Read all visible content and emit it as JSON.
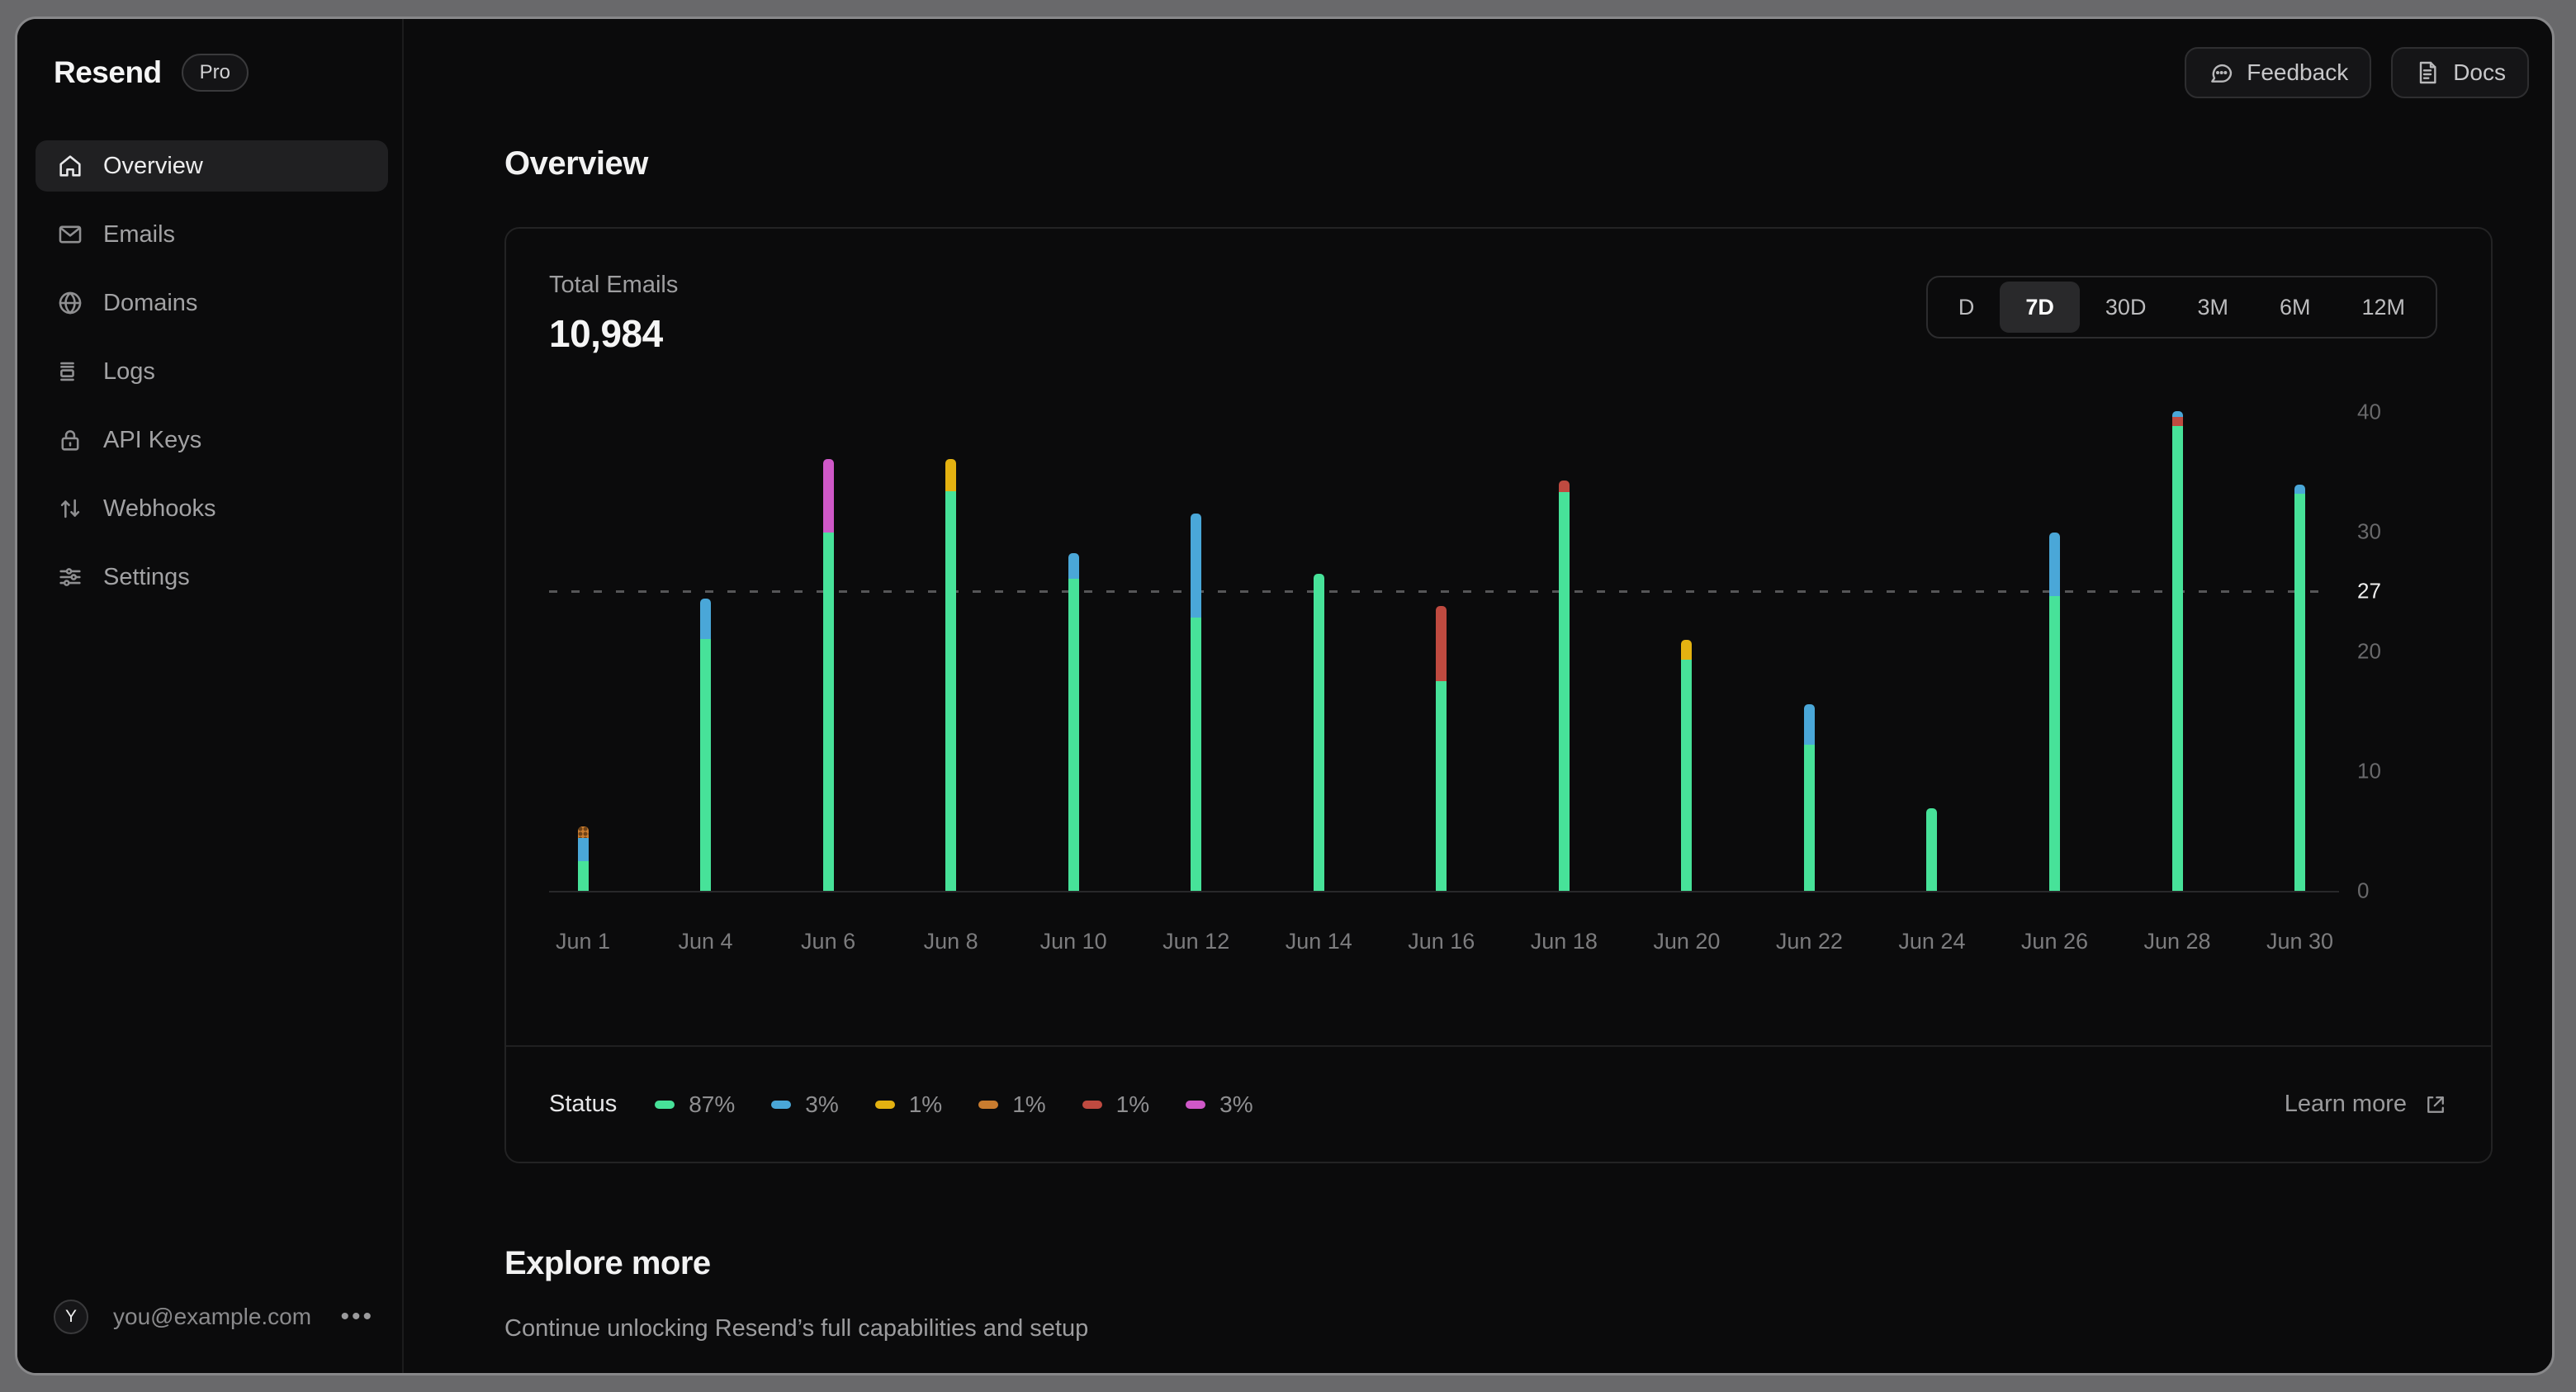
{
  "sidebar": {
    "brand": "Resend",
    "badge": "Pro",
    "items": [
      {
        "label": "Overview",
        "icon": "home-icon",
        "active": true
      },
      {
        "label": "Emails",
        "icon": "envelope-icon",
        "active": false
      },
      {
        "label": "Domains",
        "icon": "globe-icon",
        "active": false
      },
      {
        "label": "Logs",
        "icon": "logs-icon",
        "active": false
      },
      {
        "label": "API Keys",
        "icon": "lock-icon",
        "active": false
      },
      {
        "label": "Webhooks",
        "icon": "arrows-up-down-icon",
        "active": false
      },
      {
        "label": "Settings",
        "icon": "sliders-icon",
        "active": false
      }
    ],
    "user": {
      "initial": "Y",
      "email": "you@example.com"
    }
  },
  "header": {
    "feedback_label": "Feedback",
    "docs_label": "Docs"
  },
  "page_title": "Overview",
  "card": {
    "metric_label": "Total Emails",
    "metric_value": "10,984",
    "ranges": [
      "D",
      "7D",
      "30D",
      "3M",
      "6M",
      "12M"
    ],
    "active_range": "7D",
    "footer": {
      "legend_title": "Status",
      "items": [
        {
          "swatch": "green",
          "value": "87%"
        },
        {
          "swatch": "blue",
          "value": "3%"
        },
        {
          "swatch": "yellow",
          "value": "1%"
        },
        {
          "swatch": "orange",
          "value": "1%"
        },
        {
          "swatch": "red",
          "value": "1%"
        },
        {
          "swatch": "magenta",
          "value": "3%"
        }
      ],
      "learn_more": "Learn more"
    }
  },
  "chart_data": {
    "type": "bar",
    "stacked": true,
    "title": "Total Emails",
    "categories": [
      "Jun 1",
      "Jun 4",
      "Jun 6",
      "Jun 8",
      "Jun 10",
      "Jun 12",
      "Jun 14",
      "Jun 16",
      "Jun 18",
      "Jun 20",
      "Jun 22",
      "Jun 24",
      "Jun 26",
      "Jun 28",
      "Jun 30"
    ],
    "series": [
      {
        "name": "status-green",
        "color": "#47e299",
        "values": [
          2.5,
          21.0,
          29.9,
          33.4,
          26.1,
          22.8,
          26.5,
          17.5,
          33.3,
          19.3,
          12.2,
          6.9,
          24.6,
          38.8,
          33.2
        ]
      },
      {
        "name": "status-magenta",
        "color": "#cf58c8",
        "values": [
          0,
          0,
          6.2,
          0,
          0,
          0,
          0,
          0,
          0,
          0,
          0,
          0,
          0,
          0,
          0
        ]
      },
      {
        "name": "status-yellow",
        "color": "#e4b211",
        "values": [
          0,
          0,
          0,
          2.7,
          0,
          0,
          0,
          0,
          0,
          1.7,
          0,
          0,
          0,
          0,
          0
        ]
      },
      {
        "name": "status-red",
        "color": "#bf4a40",
        "values": [
          0,
          0,
          0,
          0,
          0,
          0,
          0,
          6.3,
          1.0,
          0,
          0,
          0,
          0,
          0.8,
          0
        ]
      },
      {
        "name": "status-blue",
        "color": "#4aa7d8",
        "values": [
          1.9,
          3.4,
          0,
          0,
          2.1,
          8.7,
          0,
          0,
          0,
          0,
          3.4,
          0,
          5.3,
          0.5,
          0.7
        ]
      },
      {
        "name": "status-orange",
        "color": "#c97c2f",
        "values": [
          1.0,
          0,
          0,
          0,
          0,
          0,
          0,
          0,
          0,
          0,
          0,
          0,
          0,
          0,
          0
        ]
      }
    ],
    "yticks": [
      {
        "label": "40",
        "value": 40,
        "highlight": false
      },
      {
        "label": "30",
        "value": 30,
        "highlight": false
      },
      {
        "label": "27",
        "value": 27,
        "highlight": true
      },
      {
        "label": "20",
        "value": 20,
        "highlight": false
      },
      {
        "label": "10",
        "value": 10,
        "highlight": false
      },
      {
        "label": "0",
        "value": 0,
        "highlight": false
      }
    ],
    "refline": {
      "label": "27",
      "value": 27
    },
    "ylim": [
      0,
      43
    ],
    "grid": false,
    "legend_position": "bottom"
  },
  "explore": {
    "title": "Explore more",
    "subtitle": "Continue unlocking Resend’s full capabilities and setup"
  }
}
